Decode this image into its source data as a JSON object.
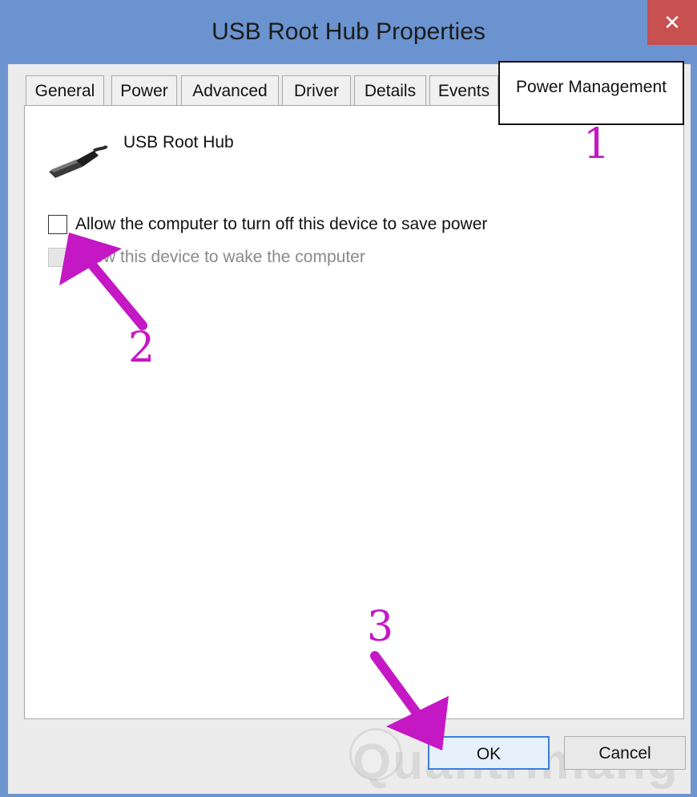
{
  "window": {
    "title": "USB Root Hub Properties",
    "close_glyph": "✕"
  },
  "tabs": [
    {
      "label": "General"
    },
    {
      "label": "Power"
    },
    {
      "label": "Advanced"
    },
    {
      "label": "Driver"
    },
    {
      "label": "Details"
    },
    {
      "label": "Events"
    },
    {
      "label": "Power Management",
      "active": true
    }
  ],
  "device": {
    "name": "USB Root Hub",
    "icon": "usb-plug-icon"
  },
  "options": [
    {
      "label": "Allow the computer to turn off this device to save power",
      "checked": false,
      "enabled": true
    },
    {
      "label": "Allow this device to wake the computer",
      "checked": false,
      "enabled": false
    }
  ],
  "buttons": {
    "ok": "OK",
    "cancel": "Cancel"
  },
  "annotations": {
    "step1": "1",
    "step2": "2",
    "step3": "3",
    "color": "#c418c4"
  },
  "watermark": {
    "text": "Quantrimang"
  }
}
